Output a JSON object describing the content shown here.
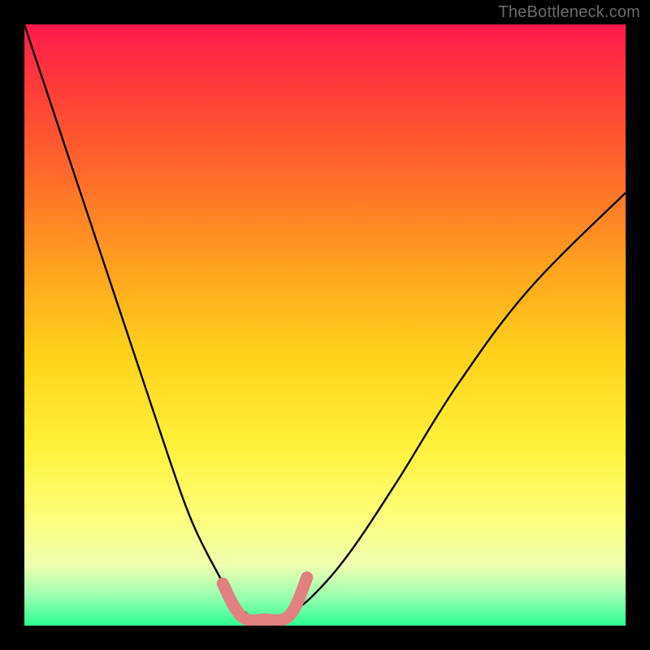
{
  "watermark": "TheBottleneck.com",
  "chart_data": {
    "type": "line",
    "title": "",
    "xlabel": "",
    "ylabel": "",
    "xlim": [
      0,
      100
    ],
    "ylim": [
      0,
      100
    ],
    "series": [
      {
        "name": "bottleneck-curve",
        "x": [
          0,
          6,
          12,
          18,
          24,
          28,
          32,
          35,
          37,
          39,
          41,
          44,
          48,
          54,
          62,
          72,
          84,
          100
        ],
        "values": [
          100,
          82,
          64,
          46,
          28,
          17,
          9,
          4,
          2,
          1,
          1,
          2,
          5,
          12,
          24,
          40,
          56,
          72
        ]
      }
    ],
    "marker_segment": {
      "name": "optimal-range",
      "color": "#e08080",
      "x": [
        33,
        35,
        37,
        40,
        43,
        45,
        47
      ],
      "values": [
        7,
        3,
        1,
        1,
        1,
        3,
        8
      ]
    },
    "grid": false,
    "legend": false
  }
}
